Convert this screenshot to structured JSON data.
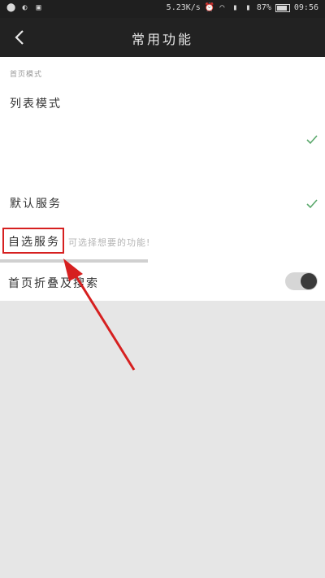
{
  "status_bar": {
    "speed": "5.23K/s",
    "battery": "87%",
    "time": "09:56",
    "battery_level": 0.87
  },
  "app_bar": {
    "title": "常用功能"
  },
  "list": {
    "section_label": "首页模式",
    "items": [
      {
        "label": "列表模式",
        "checked": false
      },
      {
        "label": "",
        "checked": true
      },
      {
        "label": "默认服务",
        "checked": true
      },
      {
        "label": "自选服务",
        "hint": "可选择想要的功能!"
      },
      {
        "label": "首页折叠及搜索",
        "toggle_on": false
      }
    ]
  },
  "colors": {
    "accent_check": "#5aa86b",
    "annotation_red": "#d62020"
  }
}
